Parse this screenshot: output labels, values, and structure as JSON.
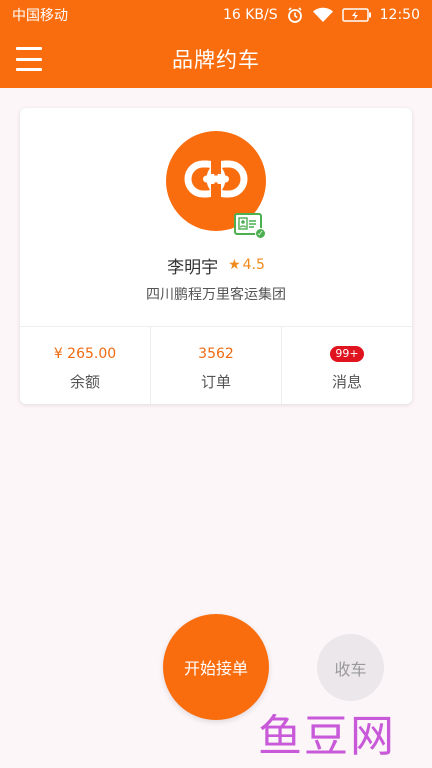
{
  "status_bar": {
    "carrier": "中国移动",
    "network_speed": "16 KB/S",
    "time": "12:50",
    "icons": [
      "alarm-icon",
      "wifi-icon",
      "battery-icon"
    ]
  },
  "app_bar": {
    "title": "品牌约车",
    "menu_icon": "menu-icon"
  },
  "driver": {
    "name": "李明宇",
    "rating": "4.5",
    "company": "四川鹏程万里客运集团",
    "avatar_icon": "link-icon",
    "badge_icon": "id-card-verified-icon"
  },
  "stats": [
    {
      "value": "¥ 265.00",
      "label": "余额"
    },
    {
      "value": "3562",
      "label": "订单"
    },
    {
      "value": "99+",
      "label": "消息"
    }
  ],
  "actions": {
    "start": "开始接单",
    "stop": "收车"
  },
  "watermark": "鱼豆网",
  "colors": {
    "primary": "#f96d0f",
    "background": "#fdf6f9",
    "badge_red": "#e0141e",
    "verified_green": "#4caf50"
  }
}
